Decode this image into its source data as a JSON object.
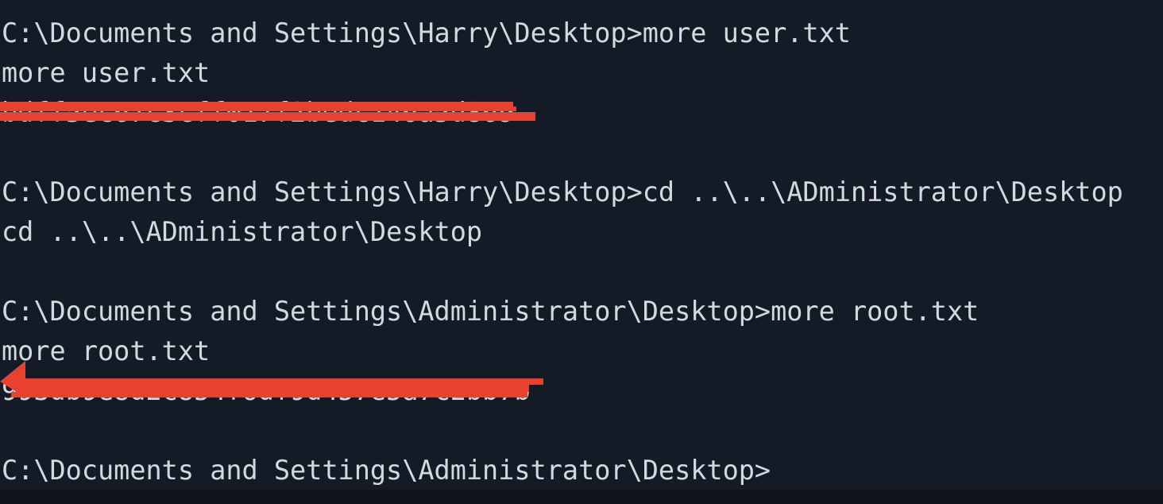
{
  "terminal": {
    "lines": {
      "l1": "C:\\Documents and Settings\\Harry\\Desktop>more user.txt",
      "l2": "more user.txt",
      "l3": "bdff5ec67c3cff017f2bedc146a5d869",
      "l4": "",
      "l5": "C:\\Documents and Settings\\Harry\\Desktop>cd ..\\..\\ADministrator\\Desktop",
      "l6": "cd ..\\..\\ADministrator\\Desktop",
      "l7": "",
      "l8": "C:\\Documents and Settings\\Administrator\\Desktop>more root.txt",
      "l9": "more root.txt",
      "l10": "993db9e8d2c854f6df9d457e5a7c2bb7b",
      "l11": "",
      "l12": "C:\\Documents and Settings\\Administrator\\Desktop>"
    }
  },
  "colors": {
    "background": "#141b26",
    "text": "#d3d9e0",
    "annotation": "#e8412d"
  }
}
